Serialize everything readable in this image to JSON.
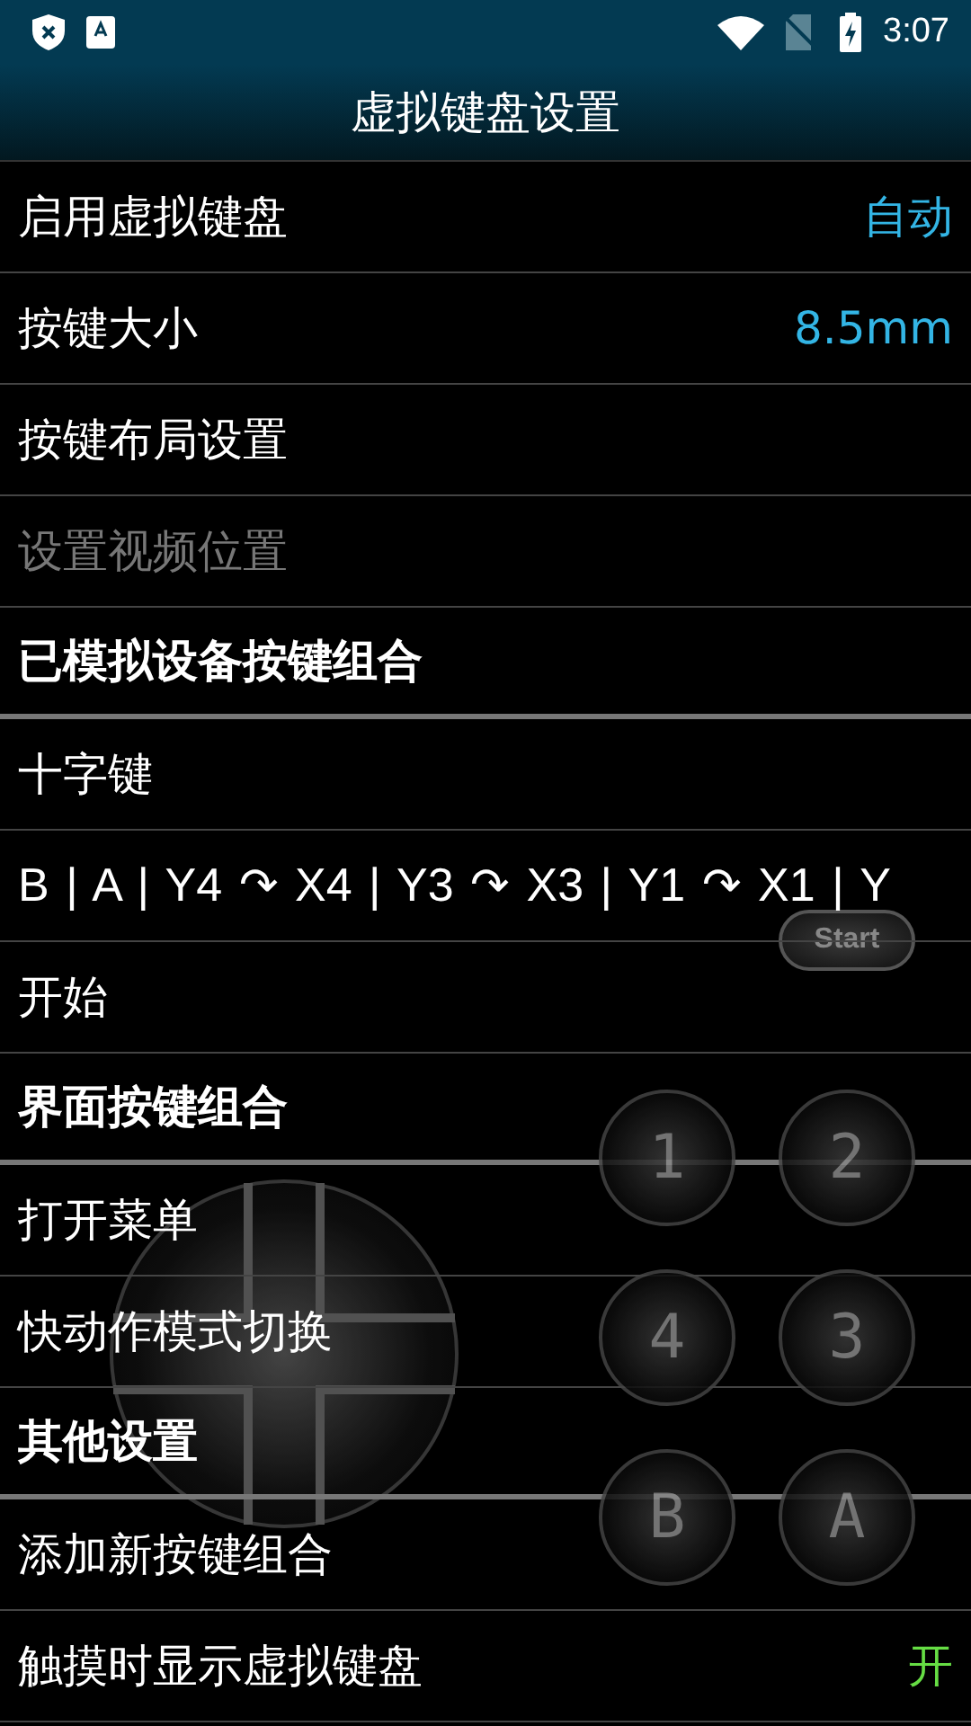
{
  "status_bar": {
    "time": "3:07"
  },
  "title": "虚拟键盘设置",
  "rows": [
    {
      "kind": "setting",
      "label": "启用虚拟键盘",
      "value": "自动",
      "color": "#33b5e5",
      "disabled": false
    },
    {
      "kind": "setting",
      "label": "按键大小",
      "value": "8.5mm",
      "color": "#33b5e5",
      "disabled": false
    },
    {
      "kind": "setting",
      "label": "按键布局设置",
      "disabled": false
    },
    {
      "kind": "setting",
      "label": "设置视频位置",
      "disabled": true
    },
    {
      "kind": "header",
      "label": "已模拟设备按键组合"
    },
    {
      "kind": "setting",
      "label": "十字键",
      "disabled": false
    },
    {
      "kind": "setting",
      "label": "B | A | Y4 ↷ X4 | Y3 ↷ X3 | Y1 ↷ X1 | Y",
      "disabled": false
    },
    {
      "kind": "setting",
      "label": "开始",
      "disabled": false
    },
    {
      "kind": "header",
      "label": "界面按键组合"
    },
    {
      "kind": "setting",
      "label": "打开菜单",
      "disabled": false
    },
    {
      "kind": "setting",
      "label": "快动作模式切换",
      "disabled": false
    },
    {
      "kind": "header",
      "label": "其他设置"
    },
    {
      "kind": "setting",
      "label": "添加新按键组合",
      "disabled": false
    },
    {
      "kind": "setting",
      "label": "触摸时显示虚拟键盘",
      "value": "开",
      "color": "#66dd44",
      "disabled": false
    }
  ],
  "overlay": {
    "start": "Start",
    "buttons": [
      "1",
      "2",
      "4",
      "3",
      "B",
      "A"
    ]
  }
}
